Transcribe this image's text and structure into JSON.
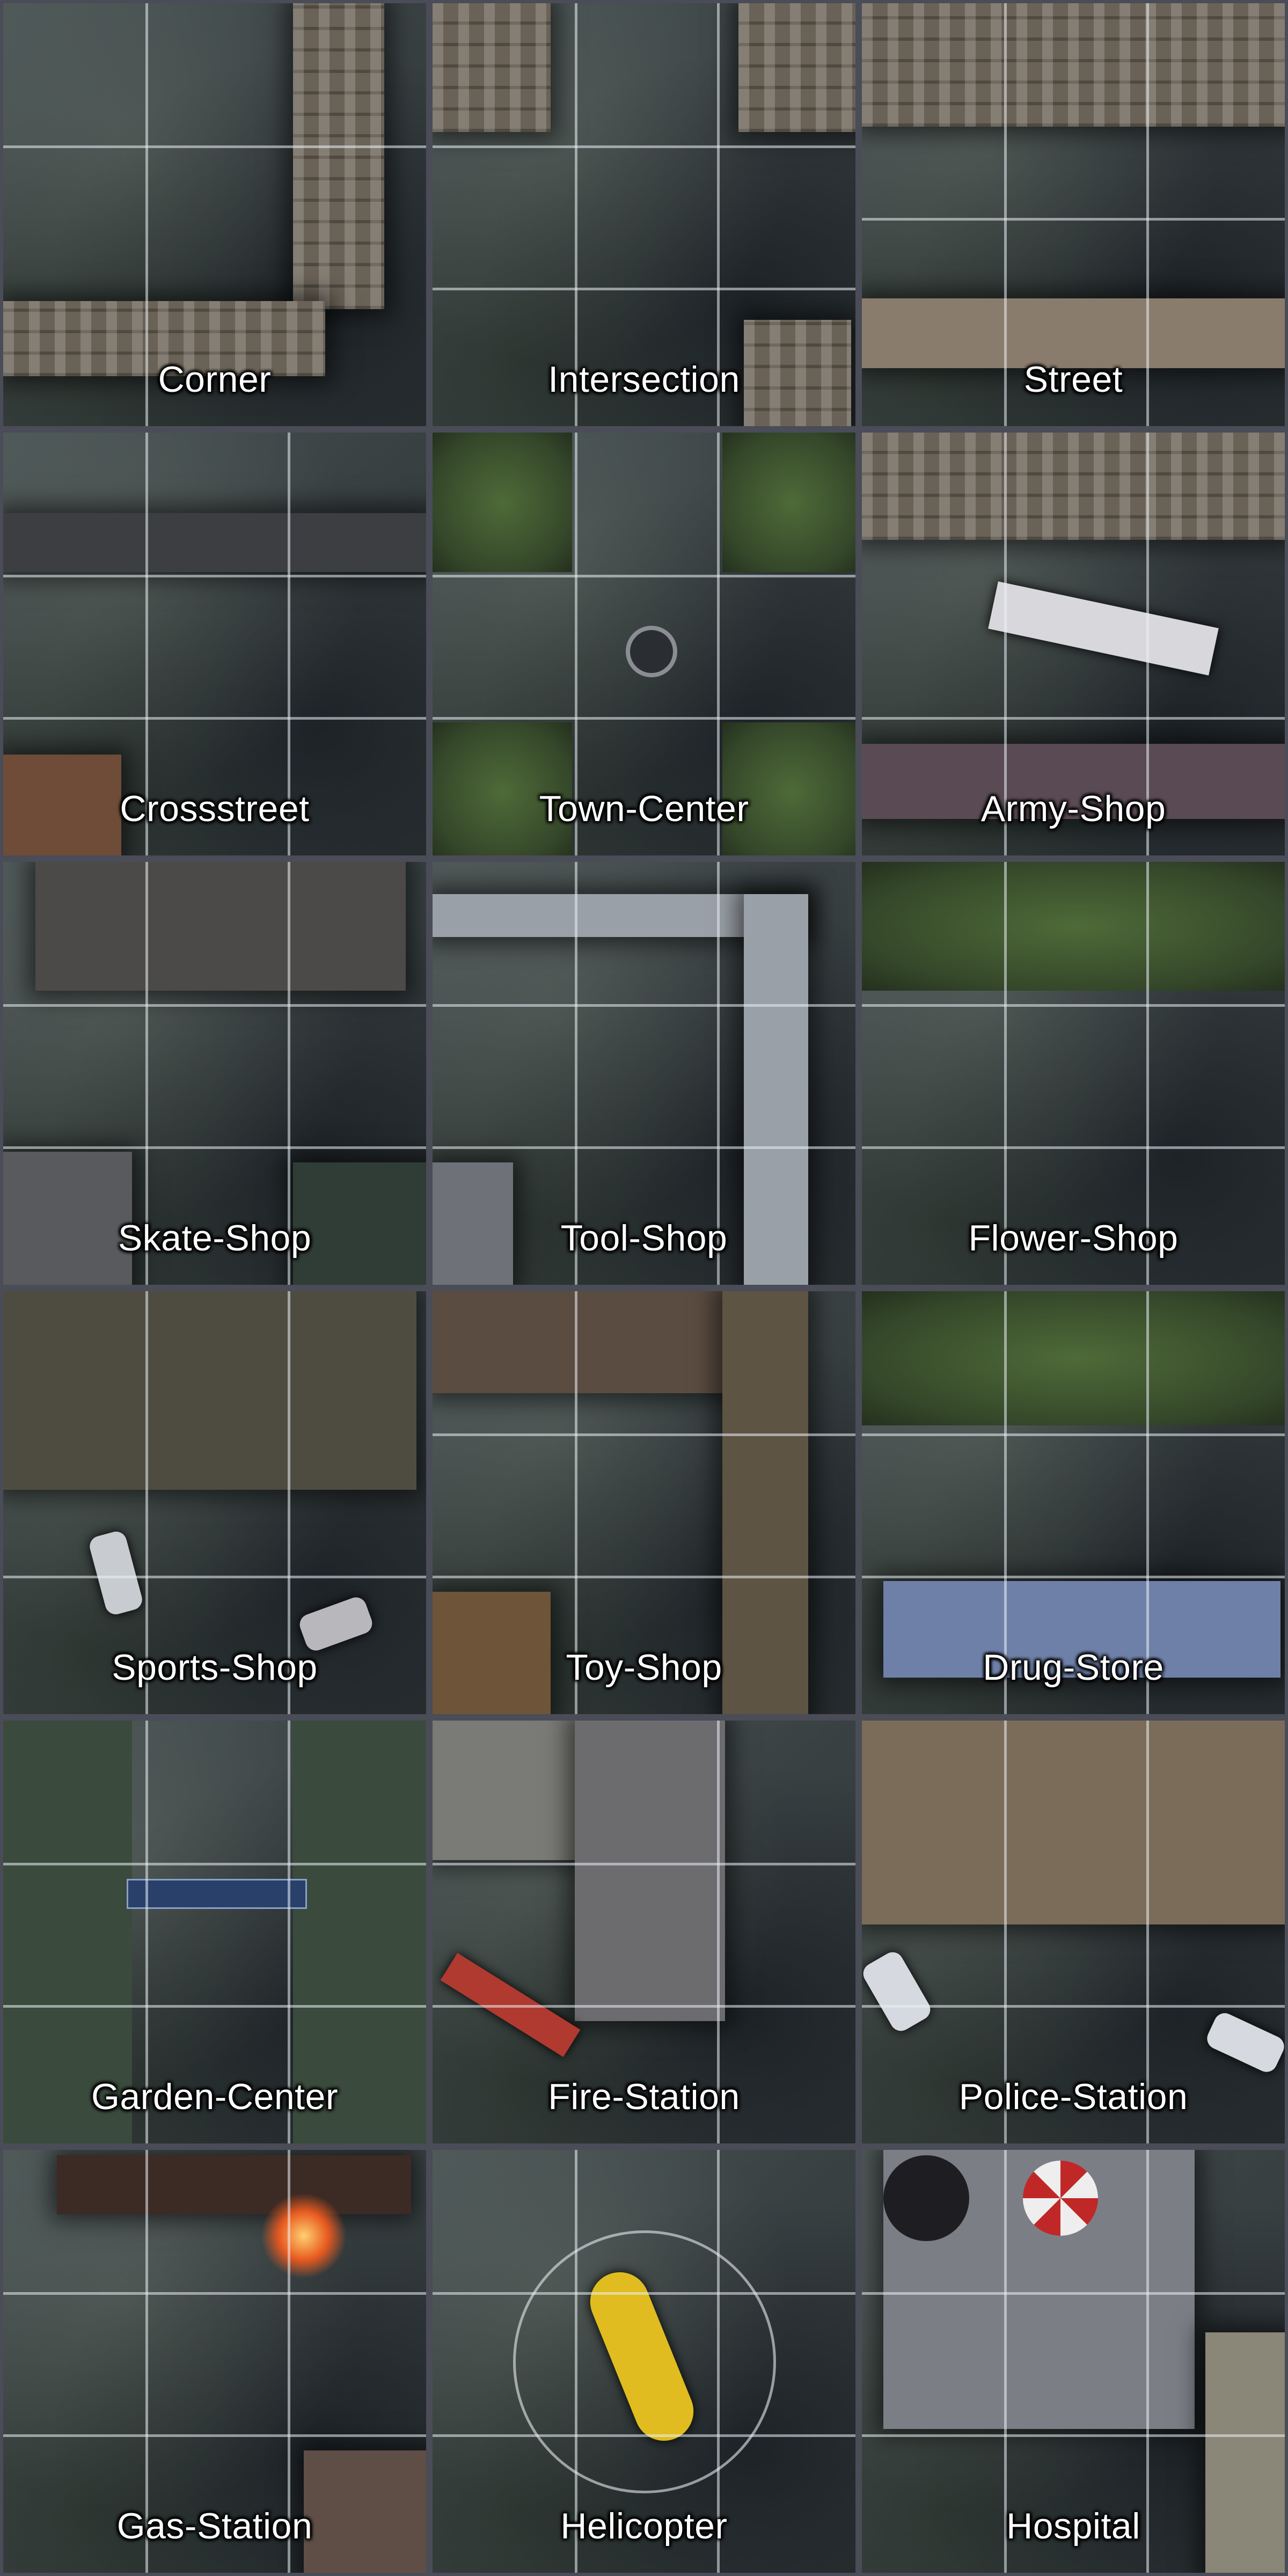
{
  "tiles": [
    {
      "label": "Corner"
    },
    {
      "label": "Intersection"
    },
    {
      "label": "Street"
    },
    {
      "label": "Crossstreet"
    },
    {
      "label": "Town-Center"
    },
    {
      "label": "Army-Shop"
    },
    {
      "label": "Skate-Shop"
    },
    {
      "label": "Tool-Shop"
    },
    {
      "label": "Flower-Shop"
    },
    {
      "label": "Sports-Shop"
    },
    {
      "label": "Toy-Shop"
    },
    {
      "label": "Drug-Store"
    },
    {
      "label": "Garden-Center"
    },
    {
      "label": "Fire-Station"
    },
    {
      "label": "Police-Station"
    },
    {
      "label": "Gas-Station"
    },
    {
      "label": "Helicopter"
    },
    {
      "label": "Hospital"
    }
  ]
}
